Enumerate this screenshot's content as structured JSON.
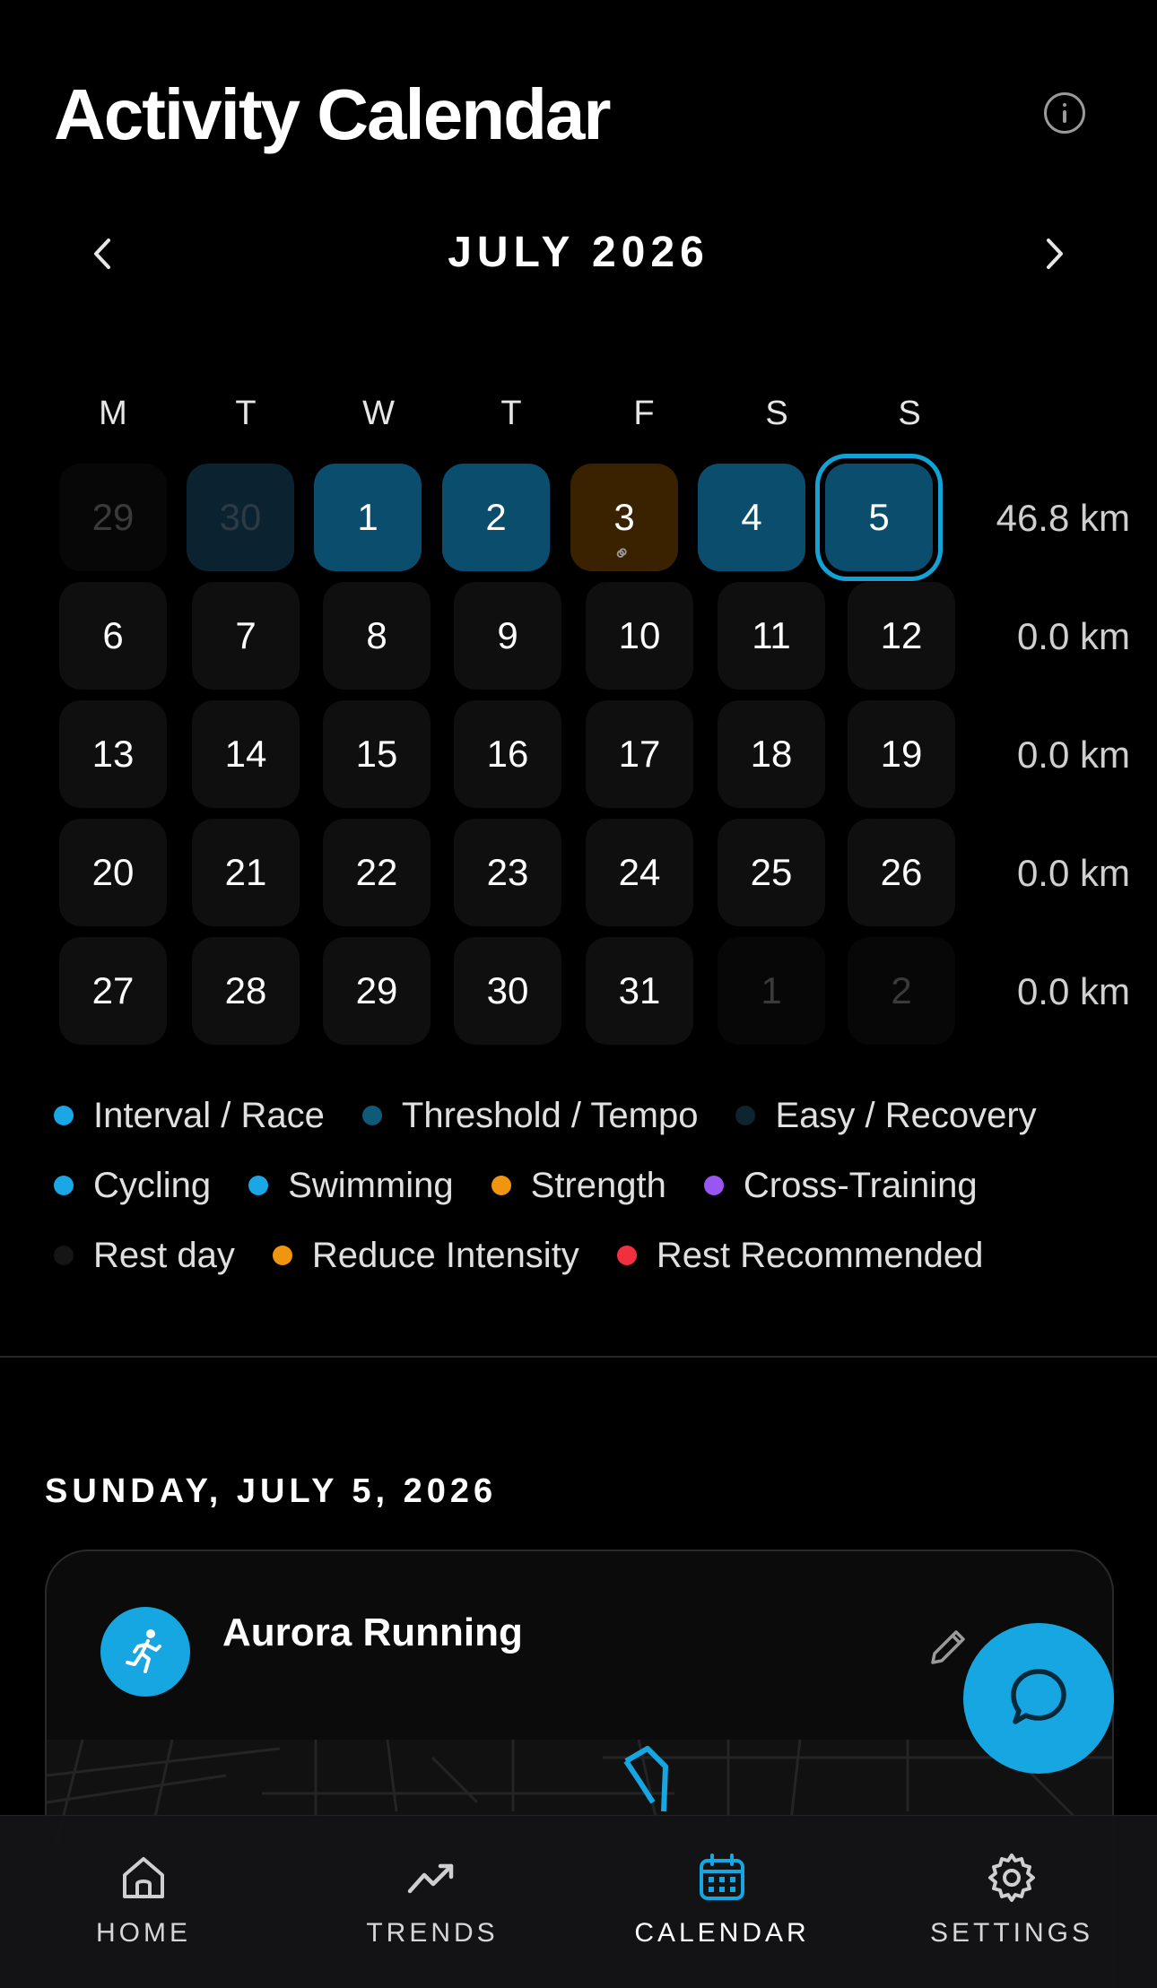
{
  "header": {
    "title": "Activity Calendar",
    "info_icon": "info-icon"
  },
  "calendar": {
    "month_label": "JULY 2026",
    "weekdays": [
      "M",
      "T",
      "W",
      "T",
      "F",
      "S",
      "S"
    ],
    "weeks": [
      {
        "days": [
          {
            "label": "29",
            "state": "muted"
          },
          {
            "label": "30",
            "state": "prev30"
          },
          {
            "label": "1",
            "state": "act"
          },
          {
            "label": "2",
            "state": "act"
          },
          {
            "label": "3",
            "state": "str"
          },
          {
            "label": "4",
            "state": "act"
          },
          {
            "label": "5",
            "state": "sel"
          }
        ],
        "distance": "46.8 km"
      },
      {
        "days": [
          {
            "label": "6"
          },
          {
            "label": "7"
          },
          {
            "label": "8"
          },
          {
            "label": "9"
          },
          {
            "label": "10"
          },
          {
            "label": "11"
          },
          {
            "label": "12"
          }
        ],
        "distance": "0.0 km"
      },
      {
        "days": [
          {
            "label": "13"
          },
          {
            "label": "14"
          },
          {
            "label": "15"
          },
          {
            "label": "16"
          },
          {
            "label": "17"
          },
          {
            "label": "18"
          },
          {
            "label": "19"
          }
        ],
        "distance": "0.0 km"
      },
      {
        "days": [
          {
            "label": "20"
          },
          {
            "label": "21"
          },
          {
            "label": "22"
          },
          {
            "label": "23"
          },
          {
            "label": "24"
          },
          {
            "label": "25"
          },
          {
            "label": "26"
          }
        ],
        "distance": "0.0 km"
      },
      {
        "days": [
          {
            "label": "27"
          },
          {
            "label": "28"
          },
          {
            "label": "29"
          },
          {
            "label": "30"
          },
          {
            "label": "31"
          },
          {
            "label": "1",
            "state": "muted"
          },
          {
            "label": "2",
            "state": "muted"
          }
        ],
        "distance": "0.0 km"
      }
    ]
  },
  "legend": [
    [
      {
        "label": "Interval / Race",
        "color": "#1aa7e6"
      },
      {
        "label": "Threshold / Tempo",
        "color": "#0f5a78"
      },
      {
        "label": "Easy / Recovery",
        "color": "#0d2530"
      }
    ],
    [
      {
        "label": "Cycling",
        "color": "#1aa7e6"
      },
      {
        "label": "Swimming",
        "color": "#1aa7e6"
      },
      {
        "label": "Strength",
        "color": "#f0950f"
      },
      {
        "label": "Cross-Training",
        "color": "#9a55f5"
      }
    ],
    [
      {
        "label": "Rest day",
        "color": "#151515"
      },
      {
        "label": "Reduce Intensity",
        "color": "#f0950f"
      },
      {
        "label": "Rest Recommended",
        "color": "#f0303c"
      }
    ]
  ],
  "selected_day": {
    "heading": "SUNDAY, JULY 5, 2026",
    "activity": {
      "title": "Aurora Running",
      "sport_icon": "running-icon",
      "edit_icon": "pencil-icon"
    }
  },
  "chat_button_icon": "chat-bubble-icon",
  "tabs": [
    {
      "label": "HOME",
      "icon": "home-icon"
    },
    {
      "label": "TRENDS",
      "icon": "trend-up-icon"
    },
    {
      "label": "CALENDAR",
      "icon": "calendar-icon",
      "active": true
    },
    {
      "label": "SETTINGS",
      "icon": "gear-icon"
    }
  ],
  "colors": {
    "accent": "#16a6e2",
    "selected_ring": "#12a2d6"
  }
}
